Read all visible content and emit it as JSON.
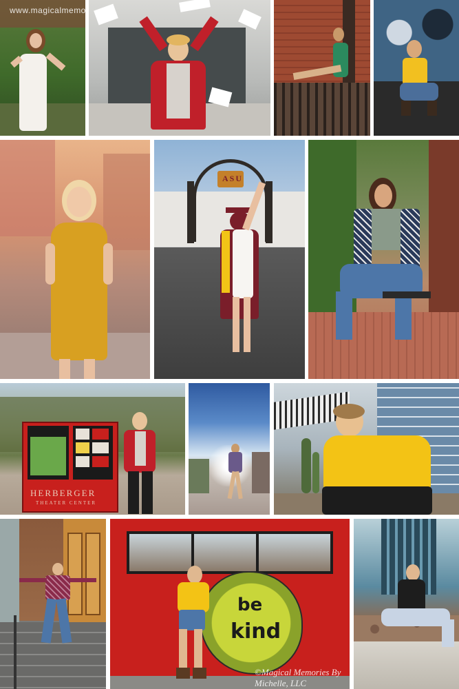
{
  "watermark_top": "www.magicalmemoriesbymichelle.com",
  "watermark_bottom": "©Magical Memories By Michelle, LLC",
  "photos": {
    "white_dress_garden": "Senior in white dress by flowering bushes",
    "red_jacket_papers": "Senior in red jacket tossing papers",
    "brick_wall_sitting": "Senior sitting on ledge by brick wall",
    "mural_crouch": "Senior crouching by graffiti mural",
    "yellow_dress_street": "Senior laughing in mustard dress",
    "asu_gates": "Graduate in cap and gown at ASU gates",
    "plaid_bench": "Senior in plaid shirt on bench",
    "theatre_sign": "Senior next to theatre sign",
    "street_sunflare": "Senior on sunlit street",
    "yellow_sweater": "Senior in yellow sweater by cactus",
    "stairs_doorway": "Senior on steps by doorway",
    "be_kind_wall": "Senior by red wall with be kind mural",
    "black_top_ledge": "Senior sitting on concrete ledge"
  },
  "sign_text": {
    "line1": "HERBERGER",
    "line2": "THEATER CENTER",
    "arch_badge": "ASU"
  },
  "mural_text": {
    "word1": "be",
    "word2": "kind"
  },
  "colors": {
    "red_wall": "#c8201d",
    "mustard": "#d8a021",
    "yellow": "#f3c315",
    "maroon": "#7a1e2a",
    "sky": "#8fb3d6"
  }
}
